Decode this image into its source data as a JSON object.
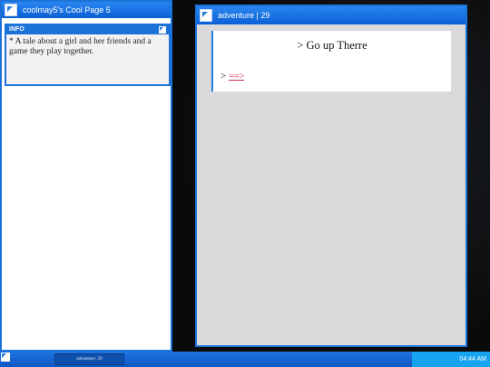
{
  "left_window": {
    "title": "coolmay5's Cool Page 5",
    "info": {
      "heading": "INFO",
      "text": "* A tale about a girl and her friends and a game they play together."
    }
  },
  "right_window": {
    "title": "adventure | 29",
    "page": {
      "command": "> Go up Therre",
      "next_prefix": ">",
      "next_link": "==>"
    }
  },
  "taskbar": {
    "task_label": "adventure | 29",
    "clock": "04:44 AM"
  },
  "colors": {
    "accent": "#1b73d9",
    "link": "#d62d4b",
    "tray": "#16a3f0"
  }
}
